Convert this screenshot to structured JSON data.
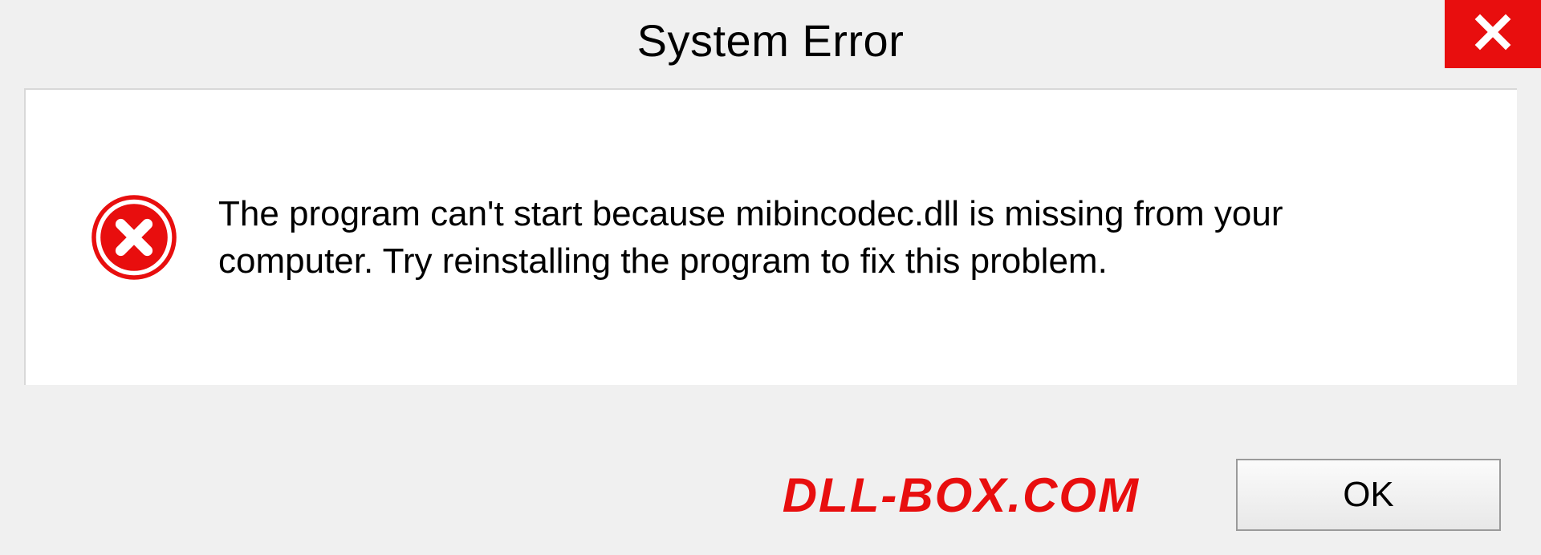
{
  "dialog": {
    "title": "System Error",
    "message": "The program can't start because mibincodec.dll is missing from your computer. Try reinstalling the program to fix this problem.",
    "ok_label": "OK"
  },
  "watermark": "DLL-BOX.COM",
  "colors": {
    "error_red": "#e80e0e",
    "close_red": "#e80e0e"
  }
}
